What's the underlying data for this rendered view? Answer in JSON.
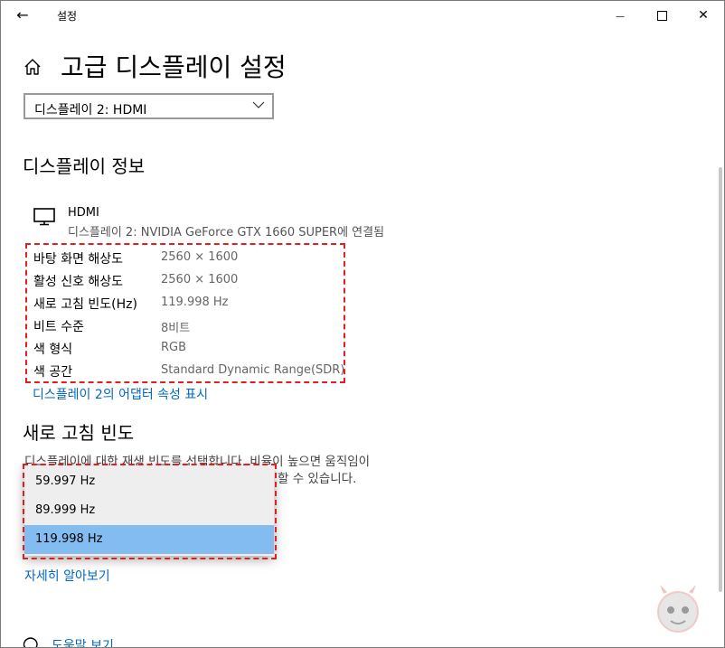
{
  "window": {
    "title": "설정",
    "back_glyph": "←",
    "minimize_glyph": "—",
    "close_glyph": "✕"
  },
  "page": {
    "title": "고급 디스플레이 설정"
  },
  "display_select": {
    "value": "디스플레이 2: HDMI"
  },
  "display_info": {
    "heading": "디스플레이 정보",
    "name": "HDMI",
    "connection": "디스플레이 2: NVIDIA GeForce GTX 1660 SUPER에 연결됨",
    "rows": [
      {
        "label": "바탕 화면 해상도",
        "value": "2560 × 1600"
      },
      {
        "label": "활성 신호 해상도",
        "value": "2560 × 1600"
      },
      {
        "label": "새로 고침 빈도(Hz)",
        "value": "119.998 Hz"
      },
      {
        "label": "비트 수준",
        "value": "8비트"
      },
      {
        "label": "색 형식",
        "value": "RGB"
      },
      {
        "label": "색 공간",
        "value": "Standard Dynamic Range(SDR)"
      }
    ],
    "adapter_link": "디스플레이 2의 어댑터 속성 표시"
  },
  "refresh_rate": {
    "heading": "새로 고침 빈도",
    "description_line1": "디스플레이에 대한 재생 빈도를 선택합니다. 비율이 높으면 움직임이",
    "description_line2_tail": "할 수 있습니다.",
    "options": [
      "59.997 Hz",
      "89.999 Hz",
      "119.998 Hz"
    ],
    "selected": "119.998 Hz",
    "learn_more_link": "자세히 알아보기"
  },
  "help": {
    "link": "도움말 보기"
  },
  "colors": {
    "accent_link": "#0067c0",
    "selected_option": "#82bcf0",
    "annotation_red": "#e02020"
  }
}
